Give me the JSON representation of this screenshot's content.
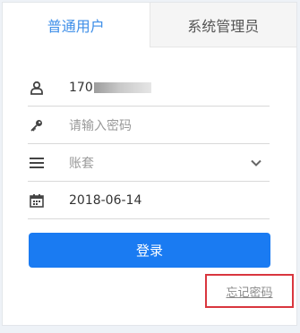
{
  "tabs": {
    "user": "普通用户",
    "admin": "系统管理员"
  },
  "form": {
    "username_value": "170",
    "password_placeholder": "请输入密码",
    "account_set_placeholder": "账套",
    "date_value": "2018-06-14"
  },
  "login_button": "登录",
  "forgot_password": "忘记密码",
  "colors": {
    "accent": "#1a7bf2",
    "active_tab_text": "#3d8ee8",
    "highlight_box": "#d9363e"
  },
  "icons": {
    "username": "user-icon",
    "password": "key-icon",
    "account_set": "list-icon",
    "date": "calendar-icon",
    "dropdown": "chevron-down-icon"
  }
}
